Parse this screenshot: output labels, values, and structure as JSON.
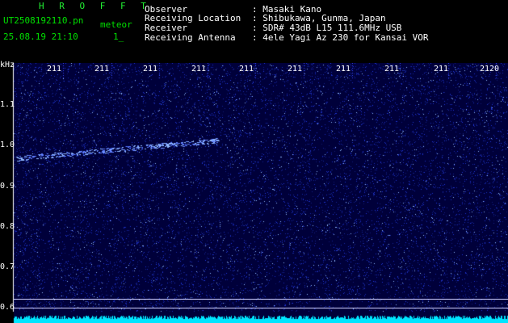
{
  "header": {
    "brand": "H R O F F T",
    "filename": "UT2508192110.pn",
    "meteor_label": "meteor",
    "datetime": "25.08.19 21:10",
    "minute_marker": "1_",
    "fields": [
      {
        "label": "Observer",
        "value": ": Masaki Kano"
      },
      {
        "label": "Receiving Location",
        "value": ": Shibukawa, Gunma, Japan"
      },
      {
        "label": "Receiver",
        "value": ": SDR# 43dB L15 111.6MHz USB"
      },
      {
        "label": "Receiving Antenna",
        "value": ": 4ele Yagi Az 230 for Kansai VOR"
      }
    ]
  },
  "spectrogram": {
    "y_unit": "kHz",
    "y_ticks": [
      "1.1",
      "1.0",
      "0.9",
      "0.8",
      "0.7",
      "0.6"
    ],
    "x_ticks": [
      "211",
      "211",
      "211",
      "211",
      "211",
      "211",
      "211",
      "211",
      "211",
      "2120"
    ],
    "colors": {
      "background": "#00003a",
      "noise": "#1f2fd0",
      "echo": "#8fb8ff",
      "trace": "#00e5ff"
    }
  }
}
